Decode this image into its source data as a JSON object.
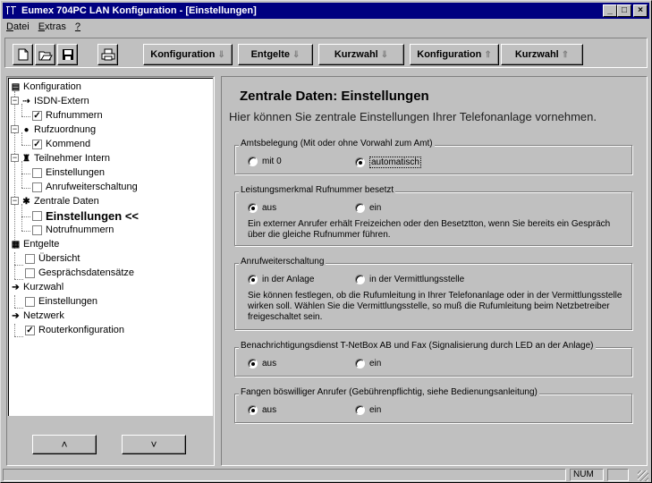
{
  "window": {
    "title": "Eumex 704PC LAN Konfiguration - [Einstellungen]"
  },
  "menu": [
    "Datei",
    "Extras",
    "?"
  ],
  "toolbar": {
    "nav_buttons": [
      {
        "label": "Konfiguration",
        "arrow": "down"
      },
      {
        "label": "Entgelte",
        "arrow": "down"
      },
      {
        "label": "Kurzwahl",
        "arrow": "down"
      },
      {
        "label": "Konfiguration",
        "arrow": "up"
      },
      {
        "label": "Kurzwahl",
        "arrow": "up"
      }
    ]
  },
  "tree": {
    "items": [
      {
        "label": "Konfiguration",
        "level": 0
      },
      {
        "label": "ISDN-Extern",
        "level": 1
      },
      {
        "label": "Rufnummern",
        "level": 2,
        "checked": true
      },
      {
        "label": "Rufzuordnung",
        "level": 1
      },
      {
        "label": "Kommend",
        "level": 2,
        "checked": true
      },
      {
        "label": "Teilnehmer Intern",
        "level": 1
      },
      {
        "label": "Einstellungen",
        "level": 2,
        "checked": false
      },
      {
        "label": "Anrufweiterschaltung",
        "level": 2,
        "checked": false
      },
      {
        "label": "Zentrale Daten",
        "level": 1
      },
      {
        "label": "Einstellungen <<",
        "level": 2,
        "checked": false,
        "current": true
      },
      {
        "label": "Notrufnummern",
        "level": 2,
        "checked": false
      },
      {
        "label": "Entgelte",
        "level": 0
      },
      {
        "label": "Übersicht",
        "level": 1,
        "checked": false
      },
      {
        "label": "Gesprächsdatensätze",
        "level": 1,
        "checked": false
      },
      {
        "label": "Kurzwahl",
        "level": 0
      },
      {
        "label": "Einstellungen",
        "level": 1,
        "checked": false
      },
      {
        "label": "Netzwerk",
        "level": 0
      },
      {
        "label": "Routerkonfiguration",
        "level": 1,
        "checked": true
      }
    ],
    "up_button": "˄",
    "down_button": "˅"
  },
  "main": {
    "heading": "Zentrale Daten: Einstellungen",
    "subheading": "Hier können Sie zentrale Einstellungen Ihrer Telefonanlage vornehmen.",
    "groups": [
      {
        "legend": "Amtsbelegung (Mit oder ohne Vorwahl zum Amt)",
        "options": [
          {
            "label": "mit 0",
            "selected": false
          },
          {
            "label": "automatisch",
            "selected": true
          }
        ],
        "description": ""
      },
      {
        "legend": "Leistungsmerkmal Rufnummer besetzt",
        "options": [
          {
            "label": "aus",
            "selected": true
          },
          {
            "label": "ein",
            "selected": false
          }
        ],
        "description": "Ein externer Anrufer erhält Freizeichen oder den Besetztton, wenn Sie bereits ein Gespräch über die gleiche Rufnummer führen."
      },
      {
        "legend": "Anrufweiterschaltung",
        "options": [
          {
            "label": "in der Anlage",
            "selected": true
          },
          {
            "label": "in der Vermittlungsstelle",
            "selected": false
          }
        ],
        "description": "Sie können festlegen, ob die Rufumleitung in Ihrer Telefonanlage oder in der Vermittlungsstelle wirken soll. Wählen Sie die Vermittlungsstelle, so muß die Rufumleitung beim Netzbetreiber freigeschaltet sein."
      },
      {
        "legend": "Benachrichtigungsdienst T-NetBox AB und Fax (Signalisierung durch LED an der Anlage)",
        "options": [
          {
            "label": "aus",
            "selected": true
          },
          {
            "label": "ein",
            "selected": false
          }
        ],
        "description": ""
      },
      {
        "legend": "Fangen böswilliger Anrufer (Gebührenpflichtig, siehe Bedienungsanleitung)",
        "options": [
          {
            "label": "aus",
            "selected": true
          },
          {
            "label": "ein",
            "selected": false
          }
        ],
        "description": ""
      }
    ]
  },
  "statusbar": {
    "num": "NUM"
  }
}
